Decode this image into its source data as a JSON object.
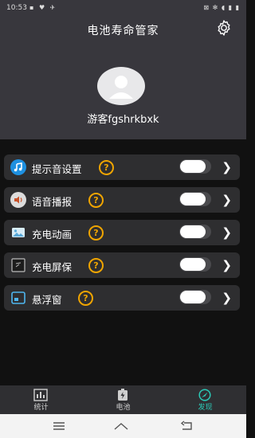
{
  "status": {
    "time": "10:53",
    "left_icons": "▪ ♥ ✈",
    "right_icons": "⊠ ✻ ◖ ▮ ▮"
  },
  "header": {
    "title": "电池寿命管家",
    "username": "游客fgshrkbxk"
  },
  "settings": [
    {
      "label": "提示音设置",
      "help": "?",
      "icon": "music-note-icon"
    },
    {
      "label": "语音播报",
      "help": "?",
      "icon": "speaker-icon"
    },
    {
      "label": "充电动画",
      "help": "?",
      "icon": "image-icon"
    },
    {
      "label": "充电屏保",
      "help": "?",
      "icon": "screen-icon"
    },
    {
      "label": "悬浮窗",
      "help": "?",
      "icon": "floating-window-icon"
    }
  ],
  "tabs": [
    {
      "label": "统计",
      "icon": "chart-icon"
    },
    {
      "label": "电池",
      "icon": "battery-icon"
    },
    {
      "label": "发现",
      "icon": "discover-icon"
    }
  ],
  "colors": {
    "header_bg": "#38373d",
    "row_bg": "#2e2e30",
    "help_accent": "#f0a500",
    "active_tab": "#2bc8b5",
    "music_icon": "#1e90e0"
  }
}
